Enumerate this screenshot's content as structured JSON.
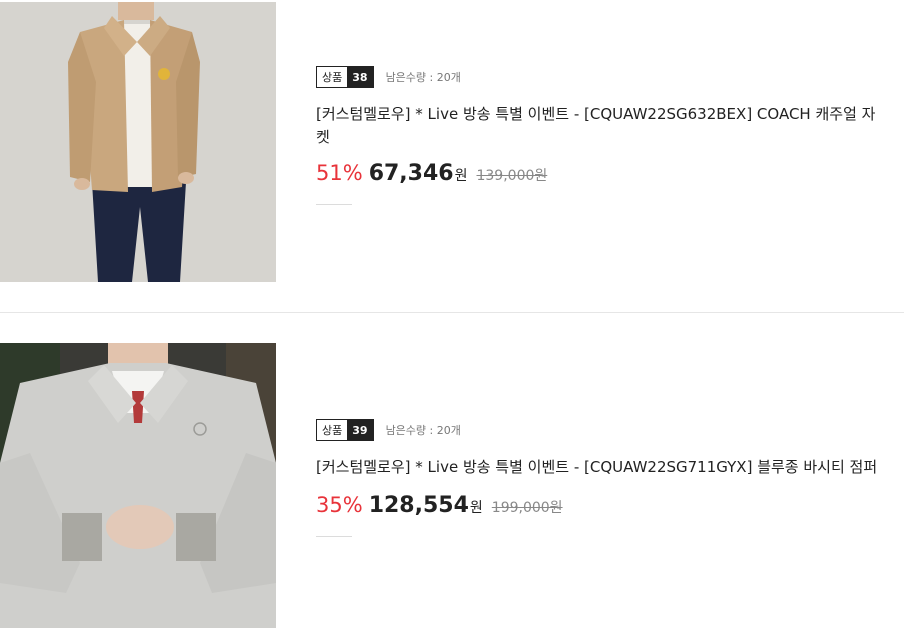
{
  "products": [
    {
      "badge_label": "상품",
      "badge_number": "38",
      "stock_text": "남은수량 : 20개",
      "title": "[커스텀멜로우] * Live 방송 특별 이벤트 - [CQUAW22SG632BEX] COACH 캐주얼 자켓",
      "discount": "51%",
      "sale_price": "67,346",
      "currency": "원",
      "original_price": "139,000원",
      "image_icon": "beige-coach-jacket-photo"
    },
    {
      "badge_label": "상품",
      "badge_number": "39",
      "stock_text": "남은수량 : 20개",
      "title": "[커스텀멜로우] * Live 방송 특별 이벤트 - [CQUAW22SG711GYX] 블루종 바시티 점퍼",
      "discount": "35%",
      "sale_price": "128,554",
      "currency": "원",
      "original_price": "199,000원",
      "image_icon": "grey-varsity-jumper-photo"
    }
  ],
  "colors": {
    "discount": "#e8333a",
    "text": "#222222",
    "muted": "#888888"
  }
}
